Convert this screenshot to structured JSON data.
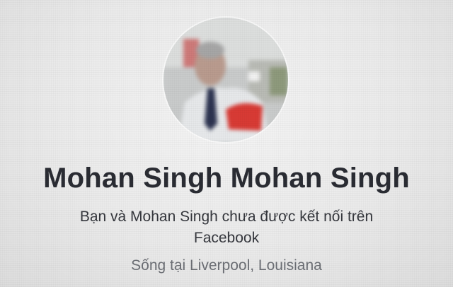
{
  "profile": {
    "name": "Mohan Singh Mohan Singh",
    "connection_status": "Bạn và Mohan Singh chưa được kết nối trên Facebook",
    "location": "Sống tại Liverpool, Louisiana"
  },
  "colors": {
    "background": "#ececec",
    "name_text": "#2a2c33",
    "body_text": "#35373d",
    "secondary_text": "#6c6f75"
  },
  "icons": {
    "avatar": "profile-photo"
  }
}
